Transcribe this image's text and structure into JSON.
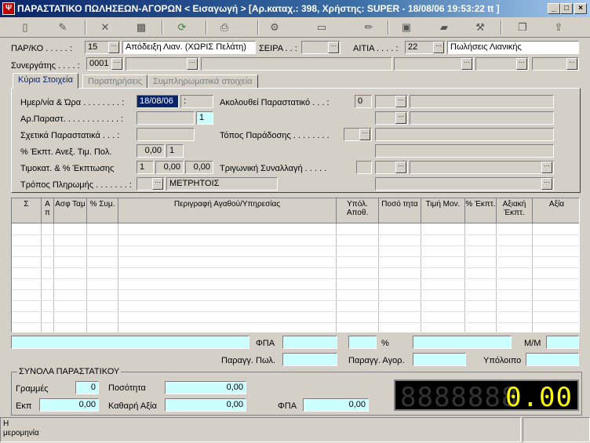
{
  "window": {
    "title": "ΠΑΡΑΣΤΑΤΙΚΟ ΠΩΛΗΣΕΩΝ-ΑΓΟΡΩΝ < Εισαγωγή > [Αρ.καταχ.: 398, Χρήστης: SUPER - 18/08/06 19:53:22 tt ]",
    "app_icon": "Ψ",
    "minimize": "_",
    "maximize": "□",
    "close": "×"
  },
  "toolbar": {
    "icons": [
      "new-document-icon",
      "edit-icon",
      "delete-icon",
      "cancel-icon",
      "refresh-icon",
      "print-icon",
      "settings-icon",
      "folder-icon",
      "pencil-icon",
      "save-icon",
      "chat-icon",
      "tools-icon",
      "copy-icon",
      "export-icon"
    ]
  },
  "header": {
    "parko_label": "ΠΑΡ/ΚΟ . . . . . :",
    "parko_code": "15",
    "parko_desc": "Απόδειξη Λιαν. (ΧΩΡΙΣ Πελάτη)",
    "seira_label": "ΣΕΙΡΑ . . :",
    "seira_value": "",
    "aitia_label": "ΑΙΤΙΑ . . . . :",
    "aitia_code": "22",
    "aitia_desc": "Πωλήσεις Λιανικής",
    "synergatis_label": "Συνεργάτης . . . . :",
    "synergatis_code": "0001"
  },
  "tabs": [
    {
      "label": "Κύρια Στοιχεία",
      "active": true
    },
    {
      "label": "Παρατηρήσεις",
      "active": false
    },
    {
      "label": "Συμπληρωματικά στοιχεία",
      "active": false
    }
  ],
  "main": {
    "date_label": "Ημερ/νία & Ώρα . . . . . . . . :",
    "date_value": "18/08/06",
    "time_value": ":",
    "ar_parast_label": "Αρ.Παραστ. . . . . . . . . . . . :",
    "ar_parast_value": "1",
    "sxetika_label": "Σχετικά Παραστατικά . . . :",
    "ekpt_label": "% Έκπτ. Ανεξ. Τιμ. Πολ.",
    "ekpt_value": "0,00",
    "ekpt_value2": "1",
    "timokat_label": "Τιμοκατ. & % Έκπτωσης",
    "timokat_value": "1",
    "timokat_v2": "0,00",
    "timokat_v3": "0,00",
    "tropos_label": "Τρόπος Πληρωμής . . . . . . . :",
    "tropos_value": "ΜΕΤΡΗΤΟΙΣ",
    "akolouthei_label": "Ακολουθεί Παραστατικό . . . :",
    "akolouthei_value": "0",
    "topos_label": "Τόπος Παράδοσης . . . . . . . .",
    "trigoniki_label": "Τριγωνική Συναλλαγή . . . . ."
  },
  "grid": {
    "headers": [
      "Σ",
      "Α π",
      "Ασφ Ταμ",
      "% Συμ.",
      "Περιγραφή Αγαθού/Υπηρεσίας",
      "Υπόλ. Αποθ.",
      "Ποσό τητα",
      "Τιμή Μον.",
      "% Έκπτ.",
      "Αξιακή Έκπτ.",
      "Αξία"
    ]
  },
  "footer": {
    "fpa_label": "ΦΠΑ",
    "percent_label": "%",
    "mm_label": "Μ/Μ",
    "parag_pol_label": "Παραγγ. Πωλ.",
    "parag_agor_label": "Παραγγ. Αγορ.",
    "ypoloipo_label": "Υπόλοιπο"
  },
  "totals": {
    "group_label": "ΣΥΝΟΛΑ ΠΑΡΑΣΤΑΤΙΚΟΥ",
    "grammes_label": "Γραμμές",
    "grammes_value": "0",
    "posotita_label": "Ποσότητα",
    "posotita_value": "0,00",
    "ekp_label": "Εκπ",
    "ekp_value": "0,00",
    "kathari_label": "Καθαρή Αξία",
    "kathari_value": "0,00",
    "fpa_label": "ΦΠΑ",
    "fpa_value": "0,00",
    "display_ghost": "8888888",
    "display_value": "0.00"
  },
  "status": {
    "line1": "Η",
    "line2": "μερομηνία"
  }
}
